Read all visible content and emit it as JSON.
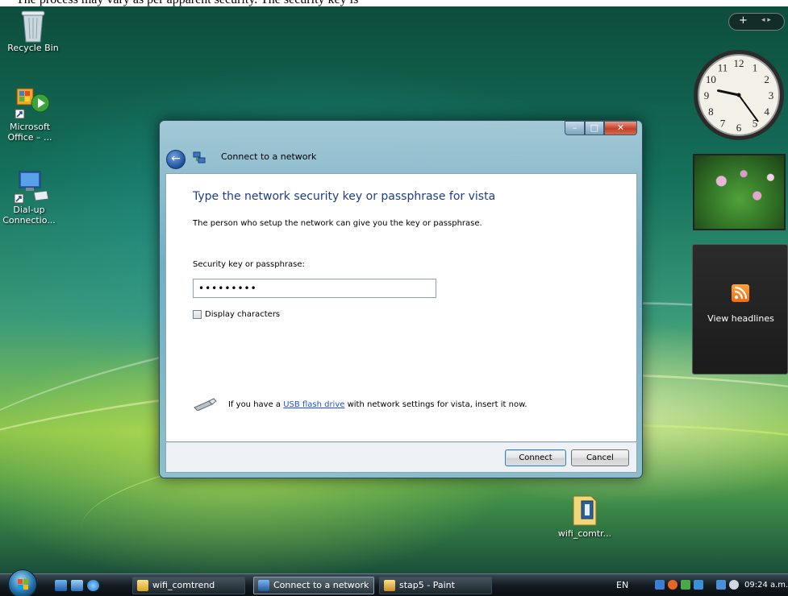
{
  "top_strip": {
    "text": "The process may vary as per apparent security. The security key is"
  },
  "desktop": {
    "icons": [
      {
        "label": "Recycle Bin"
      },
      {
        "label": "Microsoft Office – ..."
      },
      {
        "label": "Dial-up Connectio..."
      }
    ],
    "folder_label": "wifi_comtr..."
  },
  "gadgets": {
    "controls_plus": "+",
    "controls_arrows": "◂ ▸",
    "clock_numbers": [
      "12",
      "1",
      "2",
      "3",
      "4",
      "5",
      "6",
      "7",
      "8",
      "9",
      "10",
      "11"
    ],
    "clock_time": {
      "hour": 9,
      "minute": 24
    },
    "feed_label": "View headlines"
  },
  "dialog": {
    "title": "Connect to a network",
    "back_glyph": "←",
    "heading": "Type the network security key or passphrase for vista",
    "subtitle": "The person who setup the network can give you the key or passphrase.",
    "field_label": "Security key or passphrase:",
    "field_value": "•••••••••",
    "checkbox_label": "Display characters",
    "checkbox_checked": false,
    "usb_before": "If you have a ",
    "usb_link": "USB flash drive",
    "usb_after": " with network settings for vista, insert it now.",
    "connect_label": "Connect",
    "cancel_label": "Cancel",
    "window_buttons": {
      "minimize": "–",
      "maximize": "□",
      "close": "✕"
    }
  },
  "taskbar": {
    "tasks": [
      {
        "label": "wifi_comtrend",
        "active": false
      },
      {
        "label": "Connect to a network",
        "active": true
      },
      {
        "label": "stap5 - Paint",
        "active": false
      }
    ],
    "language": "EN",
    "time": "09:24 a.m."
  },
  "colors": {
    "heading_blue": "#1e3c8a",
    "link_blue": "#1a55c8"
  }
}
